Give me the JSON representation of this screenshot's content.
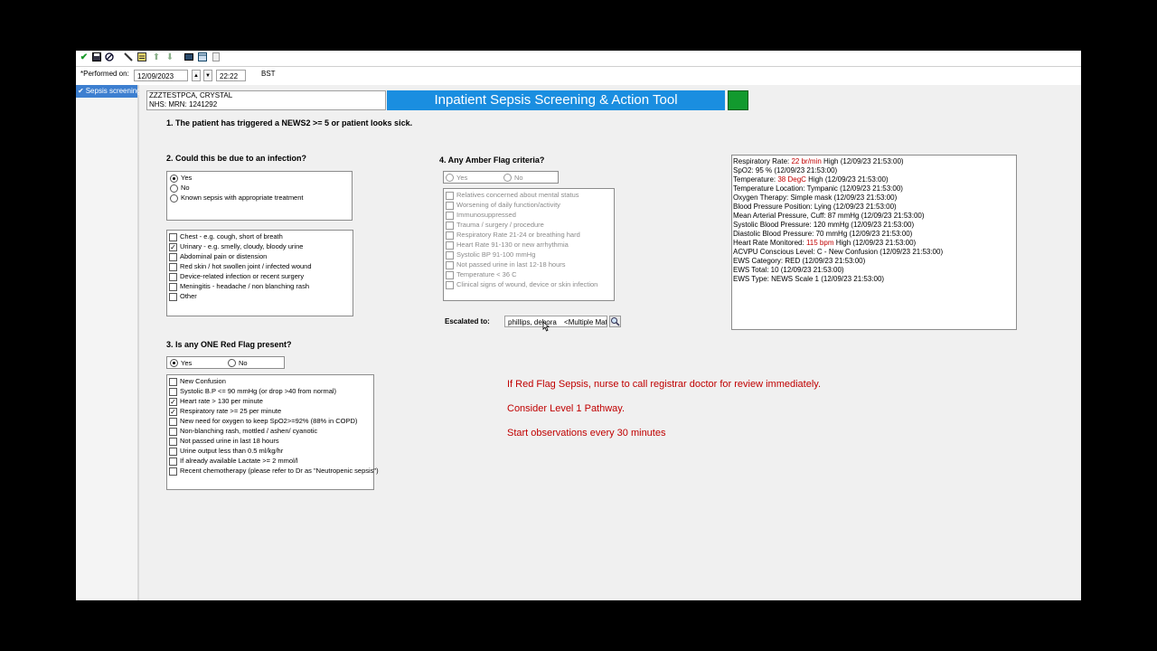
{
  "toolbar": {
    "icons": [
      "check-icon",
      "save-icon",
      "cancel-icon",
      "brush-icon",
      "form-icon",
      "up-arrow-icon",
      "down-arrow-icon",
      "screen-icon",
      "calendar-icon",
      "print-icon"
    ]
  },
  "performed": {
    "label": "*Performed on:",
    "date": "12/09/2023",
    "time": "22:22",
    "tz": "BST"
  },
  "nav": {
    "item": "Sepsis screening"
  },
  "patient": {
    "name": "ZZZTESTPCA, CRYSTAL",
    "ids": "NHS:  MRN: 1241292"
  },
  "banner": "Inpatient Sepsis Screening & Action Tool",
  "q1": "1. The patient has triggered a NEWS2 >= 5 or patient looks sick.",
  "q2": {
    "title": "2. Could this be due to an infection?",
    "options": [
      "Yes",
      "No",
      "Known sepsis with appropriate treatment"
    ],
    "sources": [
      "Chest - e.g. cough, short of breath",
      "Urinary - e.g. smelly, cloudy, bloody urine",
      "Abdominal pain or distension",
      "Red skin / hot swollen joint / infected wound",
      "Device-related infection or recent surgery",
      "Meningitis - headache / non blanching rash",
      "Other"
    ]
  },
  "q3": {
    "title": "3. Is any ONE Red Flag present?",
    "yes": "Yes",
    "no": "No",
    "flags": [
      "New Confusion",
      "Systolic B.P <= 90 mmHg (or drop >40 from normal)",
      "Heart rate > 130 per minute",
      "Respiratory rate >= 25 per minute",
      "New need for oxygen to keep SpO2>=92% (88% in COPD)",
      "Non-blanching rash, mottled / ashen/ cyanotic",
      "Not passed urine in last 18 hours",
      "Urine output less than 0.5 ml/kg/hr",
      "If already available Lactate >= 2 mmol/l",
      "Recent chemotherapy (please refer to Dr as \"Neutropenic sepsis\")"
    ]
  },
  "q4": {
    "title": "4. Any Amber Flag criteria?",
    "yes": "Yes",
    "no": "No",
    "flags": [
      "Relatives concerned about mental status",
      "Worsening of daily function/activity",
      "Immunosuppressed",
      "Trauma / surgery / procedure",
      "Respiratory Rate 21-24 or breathing hard",
      "Heart Rate 91-130 or new arrhythmia",
      "Systolic BP 91-100 mmHg",
      "Not passed urine in last 12-18 hours",
      "Temperature < 36 C",
      "Clinical signs of wound, device or skin infection"
    ]
  },
  "escalated": {
    "label": "Escalated to:",
    "value": "phillips, debora",
    "multi": "<Multiple Matches>"
  },
  "obs": {
    "rr_pre": "Respiratory Rate: ",
    "rr_val": "22 br/min",
    "rr_post": " High (12/09/23 21:53:00)",
    "spo2": "SpO2: 95 % (12/09/23 21:53:00)",
    "temp_pre": "Temperature: ",
    "temp_val": "38 DegC",
    "temp_post": " High (12/09/23 21:53:00)",
    "lines_a": [
      "Temperature Location: Tympanic (12/09/23 21:53:00)",
      "Oxygen Therapy: Simple mask (12/09/23 21:53:00)",
      "Blood Pressure Position: Lying (12/09/23 21:53:00)",
      "Mean Arterial Pressure, Cuff: 87 mmHg (12/09/23 21:53:00)",
      "Systolic Blood Pressure: 120 mmHg (12/09/23 21:53:00)",
      "Diastolic Blood Pressure: 70 mmHg (12/09/23 21:53:00)"
    ],
    "hr_pre": "Heart Rate Monitored: ",
    "hr_val": "115 bpm",
    "hr_post": " High (12/09/23 21:53:00)",
    "lines_b": [
      "ACVPU Conscious Level: C - New Confusion (12/09/23 21:53:00)",
      "EWS Category: RED (12/09/23 21:53:00)",
      "EWS Total: 10 (12/09/23 21:53:00)",
      "EWS Type: NEWS Scale 1 (12/09/23 21:53:00)"
    ]
  },
  "messages": [
    "If Red Flag Sepsis, nurse to call registrar doctor for review immediately.",
    "Consider Level 1 Pathway.",
    "Start observations every 30 minutes"
  ]
}
